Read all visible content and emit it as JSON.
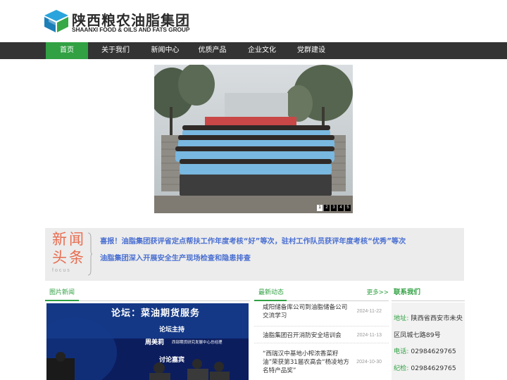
{
  "brand": {
    "name_cn": "陕西粮农油脂集团",
    "name_en": "SHAANXI FOOD & OILS AND FATS GROUP",
    "primary_color": "#31a143",
    "logo_icon": "hexagon-cube-logo-icon"
  },
  "nav": {
    "items": [
      {
        "label": "首页",
        "active": true
      },
      {
        "label": "关于我们",
        "active": false
      },
      {
        "label": "新闻中心",
        "active": false
      },
      {
        "label": "优质产品",
        "active": false
      },
      {
        "label": "企业文化",
        "active": false
      },
      {
        "label": "党群建设",
        "active": false
      }
    ]
  },
  "banner": {
    "pages": [
      "1",
      "2",
      "3",
      "4",
      "5"
    ],
    "active_page": "1"
  },
  "headlines": {
    "badge_line1": "新闻",
    "badge_line2": "头条",
    "badge_sub": "focus",
    "items": [
      "喜报！油脂集团获评省定点帮扶工作年度考核“好”等次，驻村工作队员获评年度考核“优秀”等次",
      "油脂集团深入开展安全生产现场检查和隐患排查"
    ]
  },
  "picture_news": {
    "title": "图片新闻",
    "slide": {
      "line1": "论坛：菜油期货服务",
      "line2": "论坛主持",
      "line3": "周美莉",
      "line3b": "西部期货研究发展中心总经理",
      "line4": "讨论嘉宾"
    }
  },
  "latest_news": {
    "title": "最新动态",
    "more": "更多>>",
    "items": [
      {
        "title": "咸阳储备库公司到油脂储备公司交流学习",
        "date": "2024-11-22"
      },
      {
        "title": "油脂集团召开消防安全培训会",
        "date": "2024-11-13"
      },
      {
        "title": "“西瑞汉中基地小榨浓香菜籽油”荣获第31届农高会“杨凌地方名特产品奖”",
        "date": "2024-10-30"
      }
    ]
  },
  "contact": {
    "title": "联系我们",
    "address_label": "地址:",
    "address_1": "陕西省西安市未央",
    "address_2": "区凤城七路89号",
    "phone_label": "电话:",
    "phone": "02984629765",
    "qc_label": "纪检:",
    "qc": "02984629765"
  }
}
